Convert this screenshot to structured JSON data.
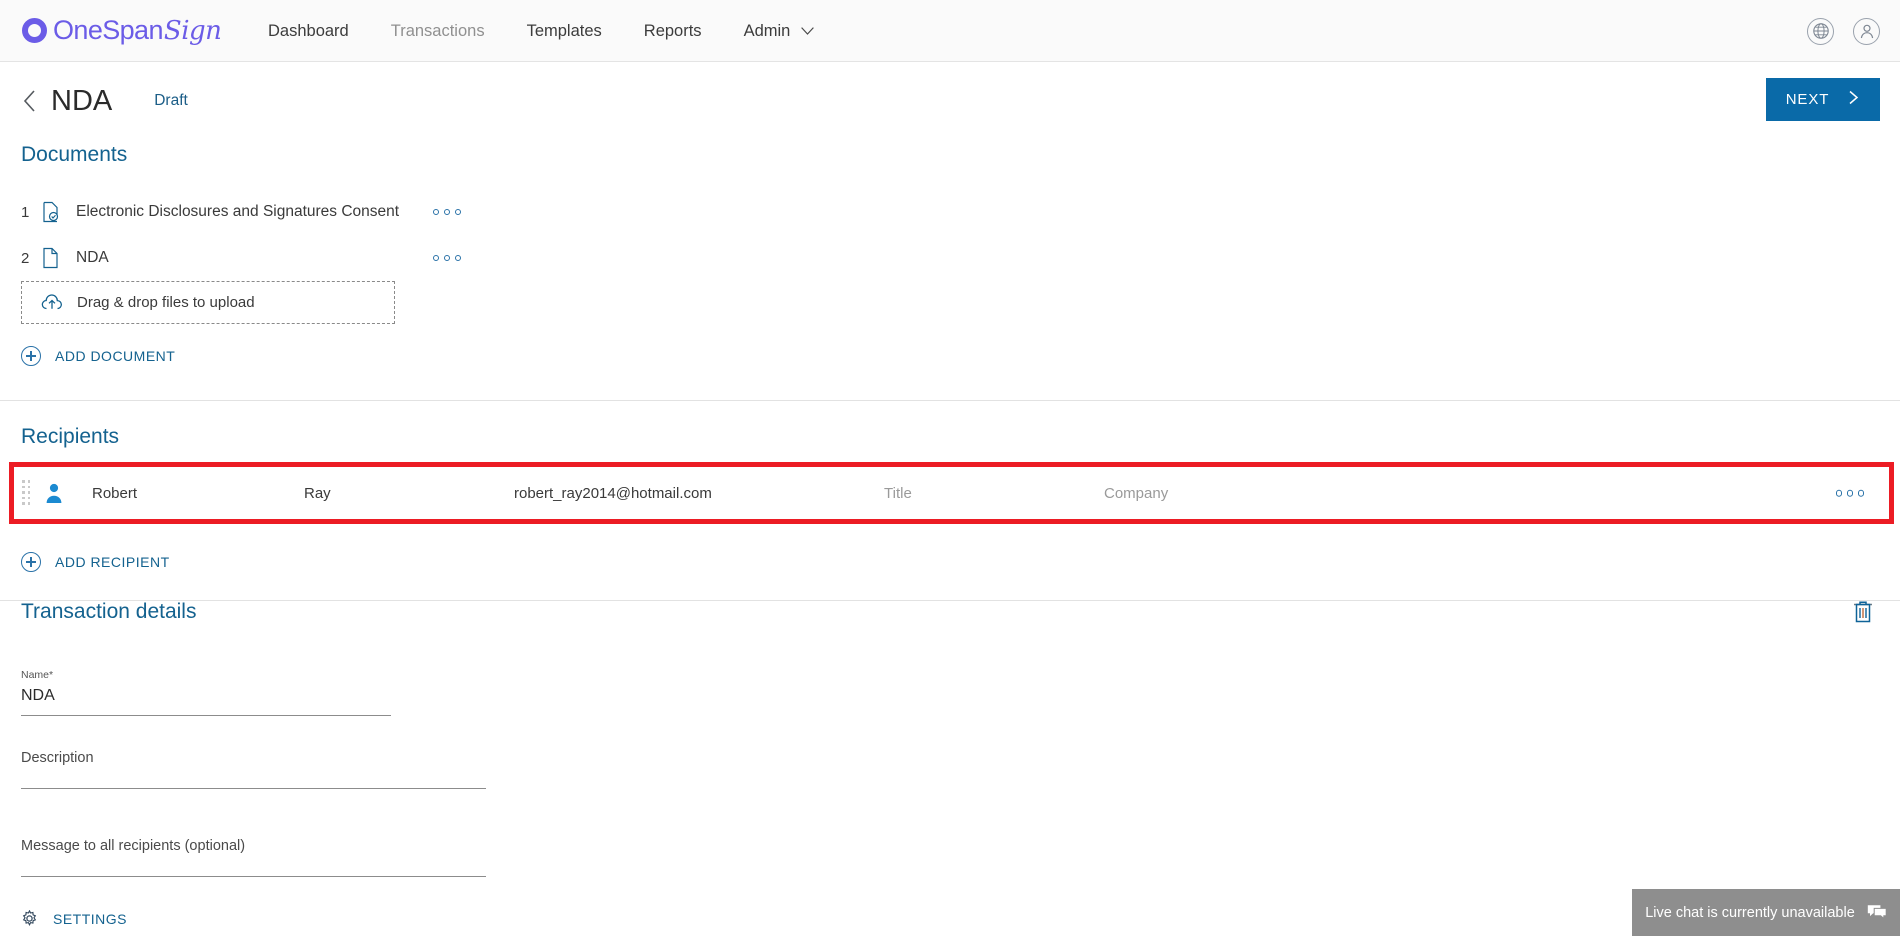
{
  "topnav": {
    "logo_text": "OneSpan",
    "logo_script": "Sign",
    "links": [
      {
        "label": "Dashboard",
        "muted": false
      },
      {
        "label": "Transactions",
        "muted": true
      },
      {
        "label": "Templates",
        "muted": false
      },
      {
        "label": "Reports",
        "muted": false
      },
      {
        "label": "Admin",
        "muted": false,
        "caret": true
      }
    ],
    "right_icons": [
      {
        "name": "globe-icon"
      },
      {
        "name": "account-icon"
      }
    ]
  },
  "pagehead": {
    "back_icon": "back-chevron-icon",
    "title": "NDA",
    "status": "Draft",
    "next_label": "NEXT"
  },
  "documents": {
    "heading": "Documents",
    "rows": [
      {
        "num": "1",
        "name": "Electronic Disclosures and Signatures Consent",
        "icon": "document-check-icon"
      },
      {
        "num": "2",
        "name": "NDA",
        "icon": "document-icon"
      }
    ],
    "dropzone_label": "Drag & drop files to upload",
    "add_label": "ADD DOCUMENT"
  },
  "recipients": {
    "heading": "Recipients",
    "highlight_color": "#ec1c24",
    "row": {
      "first_name": "Robert",
      "last_name": "Ray",
      "email": "robert_ray2014@hotmail.com",
      "title_placeholder": "Title",
      "company_placeholder": "Company"
    },
    "add_label": "ADD RECIPIENT"
  },
  "transaction": {
    "heading": "Transaction details",
    "name_label": "Name",
    "name_required": "*",
    "name_value": "NDA",
    "description_placeholder": "Description",
    "description_value": "",
    "message_placeholder": "Message to all recipients (optional)",
    "message_value": "",
    "settings_label": "SETTINGS",
    "delete_icon": "trash-icon"
  },
  "livechat": {
    "text": "Live chat is currently unavailable",
    "icon": "chat-bubble-icon"
  }
}
